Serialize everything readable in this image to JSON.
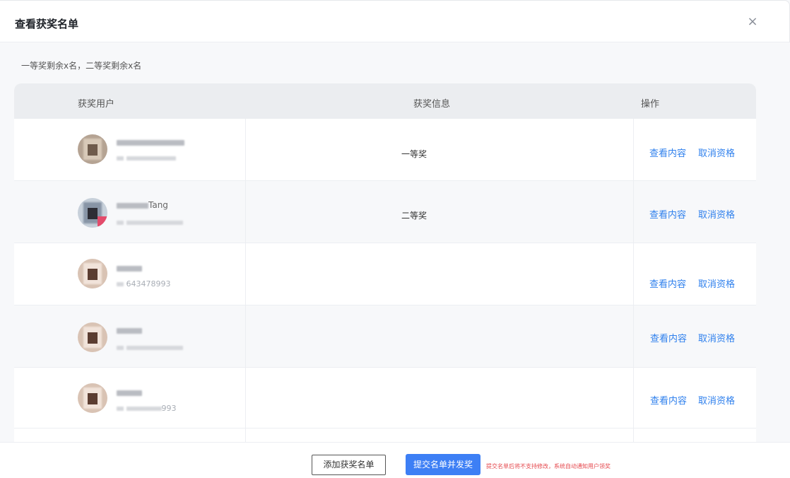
{
  "modal": {
    "title": "查看获奖名单",
    "close_glyph": "×"
  },
  "remaining_text": "一等奖剩余x名，二等奖剩余x名",
  "table": {
    "headers": {
      "user": "获奖用户",
      "info": "获奖信息",
      "op": "操作"
    },
    "rows": [
      {
        "nickname": "",
        "id_label": "ID:",
        "id_value": "",
        "prize": "一等奖",
        "op_view": "查看内容",
        "op_cancel": "取消资格"
      },
      {
        "nickname": "Tang",
        "id_label": "ID:",
        "id_value": "",
        "prize": "二等奖",
        "op_view": "查看内容",
        "op_cancel": "取消资格"
      },
      {
        "nickname": "",
        "id_label": "ID:",
        "id_value": "643478993",
        "prize": "",
        "op_view": "查看内容",
        "op_cancel": "取消资格"
      },
      {
        "nickname": "",
        "id_label": "ID:",
        "id_value": "",
        "prize": "",
        "op_view": "查看内容",
        "op_cancel": "取消资格"
      },
      {
        "nickname": "",
        "id_label": "ID:",
        "id_value": "993",
        "prize": "",
        "op_view": "查看内容",
        "op_cancel": "取消资格"
      }
    ]
  },
  "footer": {
    "add_button": "添加获奖名单",
    "submit_button": "提交名单并发奖",
    "note": "提交名单后将不支持修改，系统自动通知用户领奖"
  },
  "colors": {
    "link": "#2f80ed",
    "primary": "#3d7ff5",
    "warning": "#e5484d"
  }
}
